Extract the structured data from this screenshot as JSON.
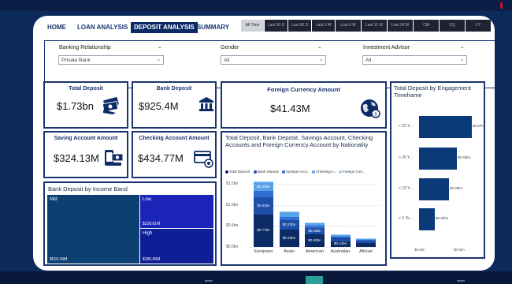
{
  "nav": {
    "tabs": [
      {
        "label": "HOME",
        "active": false
      },
      {
        "label": "LOAN ANALYSIS",
        "active": false
      },
      {
        "label": "DEPOSIT ANALYSIS",
        "active": true
      },
      {
        "label": "SUMMARY",
        "active": false
      }
    ],
    "periods": [
      {
        "label": "All Time",
        "active": true
      },
      {
        "label": "Last 30 D",
        "active": false
      },
      {
        "label": "Last 90 D",
        "active": false
      },
      {
        "label": "Last 3 M",
        "active": false
      },
      {
        "label": "Last 6 M",
        "active": false
      },
      {
        "label": "Last 12 M",
        "active": false
      },
      {
        "label": "Last 24 M",
        "active": false
      },
      {
        "label": "CM",
        "active": false
      },
      {
        "label": "CQ",
        "active": false
      },
      {
        "label": "CY",
        "active": false
      }
    ]
  },
  "filters": {
    "banking_relationship": {
      "label": "Banking Relationship",
      "value": "Private Bank"
    },
    "gender": {
      "label": "Gender",
      "value": "All"
    },
    "investment_advisor": {
      "label": "Investment Advisor",
      "value": "All"
    }
  },
  "kpis": {
    "total_deposit": {
      "title": "Total Deposit",
      "value": "$1.73bn",
      "icon": "cash-icon"
    },
    "bank_deposit": {
      "title": "Bank Deposit",
      "value": "$925.4M",
      "icon": "bank-icon"
    },
    "foreign_currency": {
      "title": "Foreign Currency Amount",
      "value": "$41.43M",
      "icon": "globe-currency-icon"
    },
    "saving_account": {
      "title": "Saving Account Amount",
      "value": "$324.13M",
      "icon": "mobile-money-icon"
    },
    "checking_account": {
      "title": "Checking Account Amount",
      "value": "$434.77M",
      "icon": "card-icon"
    }
  },
  "treemap": {
    "title": "Bank Deposit by Income Band",
    "cells": [
      {
        "label": "Mid",
        "value": "$510.43M"
      },
      {
        "label": "Low",
        "value": "$228.01M"
      },
      {
        "label": "High",
        "value": "$186.96M"
      }
    ]
  },
  "nationality_chart": {
    "title": "Total Deposit, Bank Deposit, Savings Account, Checking Accounts and Foreign Currency Account by Nationality",
    "legend": [
      "Total Deposit",
      "Bank Deposit",
      "Savings Acco...",
      "Checking A...",
      "Foreign Curr..."
    ],
    "yticks": [
      "$1.5bn",
      "$1.0bn",
      "$0.5bn",
      "$0.0bn"
    ],
    "colors": [
      "#0b2a66",
      "#1e4fa8",
      "#2f6fd6",
      "#5aa2e8",
      "#9fd0f5"
    ]
  },
  "engagement_chart": {
    "title": "Total Deposit by Engagement Timeframe",
    "xticks": [
      "$0.0bn",
      "$0.5bn"
    ]
  },
  "chart_data": [
    {
      "type": "treemap",
      "title": "Bank Deposit by Income Band",
      "categories": [
        "Mid",
        "Low",
        "High"
      ],
      "values": [
        510.43,
        228.01,
        186.96
      ],
      "unit": "$M"
    },
    {
      "type": "bar",
      "stacked": true,
      "title": "Total Deposit, Bank Deposit, Savings Account, Checking Accounts and Foreign Currency Account by Nationality",
      "categories": [
        "European",
        "Asian",
        "American",
        "Australian",
        "African"
      ],
      "unit": "$bn",
      "ylim": [
        0,
        1.5
      ],
      "series": [
        {
          "name": "Total Deposit",
          "values": [
            0.77,
            0.42,
            0.3,
            0.14,
            0.1
          ]
        },
        {
          "name": "Bank Deposit",
          "values": [
            0.41,
            0.22,
            0.15,
            0.08,
            0.05
          ]
        },
        {
          "name": "Savings Acco...",
          "values": [
            0.15,
            0.08,
            0.05,
            0.03,
            0.02
          ]
        },
        {
          "name": "Checking A...",
          "values": [
            0.2,
            0.11,
            0.08,
            0.04,
            0.03
          ]
        },
        {
          "name": "Foreign Curr...",
          "values": [
            0.02,
            0.01,
            0.01,
            0.005,
            0.004
          ]
        }
      ],
      "data_labels": [
        [
          "$0.77bn",
          "$0.41bn",
          "$0.20bn"
        ],
        [
          "$0.42bn",
          "$0.22bn"
        ],
        [
          "$0.30bn",
          "$0.15bn"
        ],
        [
          "$0.14bn"
        ],
        []
      ]
    },
    {
      "type": "bar",
      "orientation": "horizontal",
      "title": "Total Deposit by Engagement Timeframe",
      "categories": [
        "< 20 Y...",
        "> 20 Y...",
        "< 10 Y...",
        "< 5 Ye..."
      ],
      "values": [
        0.67,
        0.48,
        0.38,
        0.2
      ],
      "value_labels": [
        "$0.67bn",
        "$0.48bn",
        "$0.38bn",
        "$0.20bn"
      ],
      "unit": "$bn",
      "xlim": [
        0,
        0.7
      ]
    }
  ]
}
